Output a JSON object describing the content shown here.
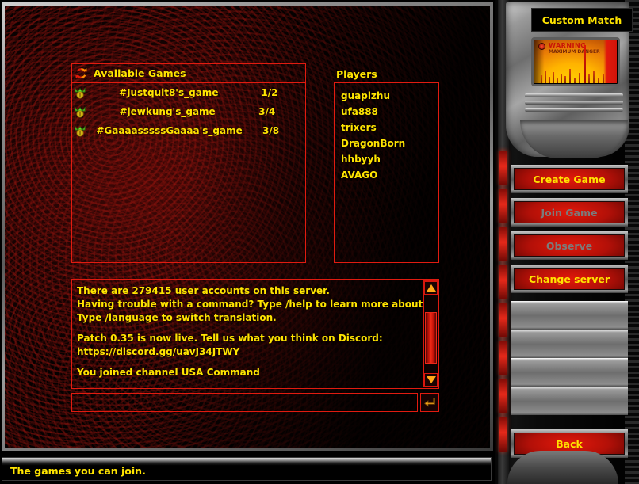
{
  "window": {
    "sidebar_title": "Custom Match",
    "status_text": "The games you can join."
  },
  "games_panel": {
    "refresh_icon": "refresh-icon",
    "header_label": "Available Games",
    "rows": [
      {
        "icon": "game-flag-icon",
        "name": "#Justquit8's_game",
        "count": "1/2",
        "fill_pct": 50
      },
      {
        "icon": "game-flag-icon",
        "name": "#jewkung's_game",
        "count": "3/4",
        "fill_pct": 75
      },
      {
        "icon": "game-flag-icon",
        "name": "#GaaaasssssGaaaa's_game",
        "count": "3/8",
        "fill_pct": 38
      }
    ]
  },
  "players_panel": {
    "label": "Players",
    "items": [
      "guapizhu",
      "ufa888",
      "trixers",
      "DragonBorn",
      "hhbyyh",
      "AVAGO"
    ]
  },
  "chat": {
    "lines": [
      {
        "text": "There are 279415 user accounts on this server.",
        "blank": false
      },
      {
        "text": "Having trouble with a command? Type /help to learn more about it.",
        "blank": false
      },
      {
        "text": "Type /language to switch translation.",
        "blank": false
      },
      {
        "text": "",
        "blank": true
      },
      {
        "text": "Patch 0.35 is now live. Tell us what you think on Discord:",
        "blank": false
      },
      {
        "text": "https://discord.gg/uavJ34JTWY",
        "blank": false
      },
      {
        "text": "",
        "blank": true
      },
      {
        "text": "You joined channel USA Command",
        "blank": false
      }
    ],
    "input_value": "",
    "input_placeholder": "",
    "send_icon": "enter-arrow-icon",
    "scroll_up_icon": "triangle-up-icon",
    "scroll_down_icon": "triangle-down-icon"
  },
  "sidebar": {
    "screen": {
      "warning_label": "WARNING",
      "sub_label": "MAXIMUM DANGER"
    },
    "buttons": [
      {
        "label": "Create Game",
        "enabled": true
      },
      {
        "label": "Join Game",
        "enabled": false
      },
      {
        "label": "Observe",
        "enabled": false
      },
      {
        "label": "Change server",
        "enabled": true
      }
    ],
    "empty_slot_count": 4,
    "back_button": {
      "label": "Back",
      "enabled": true
    }
  },
  "colors": {
    "accent_yellow": "#ffe400",
    "accent_red": "#e11b10",
    "disabled_gray": "#7b7b7b",
    "bar_orange": "#e8a227"
  }
}
